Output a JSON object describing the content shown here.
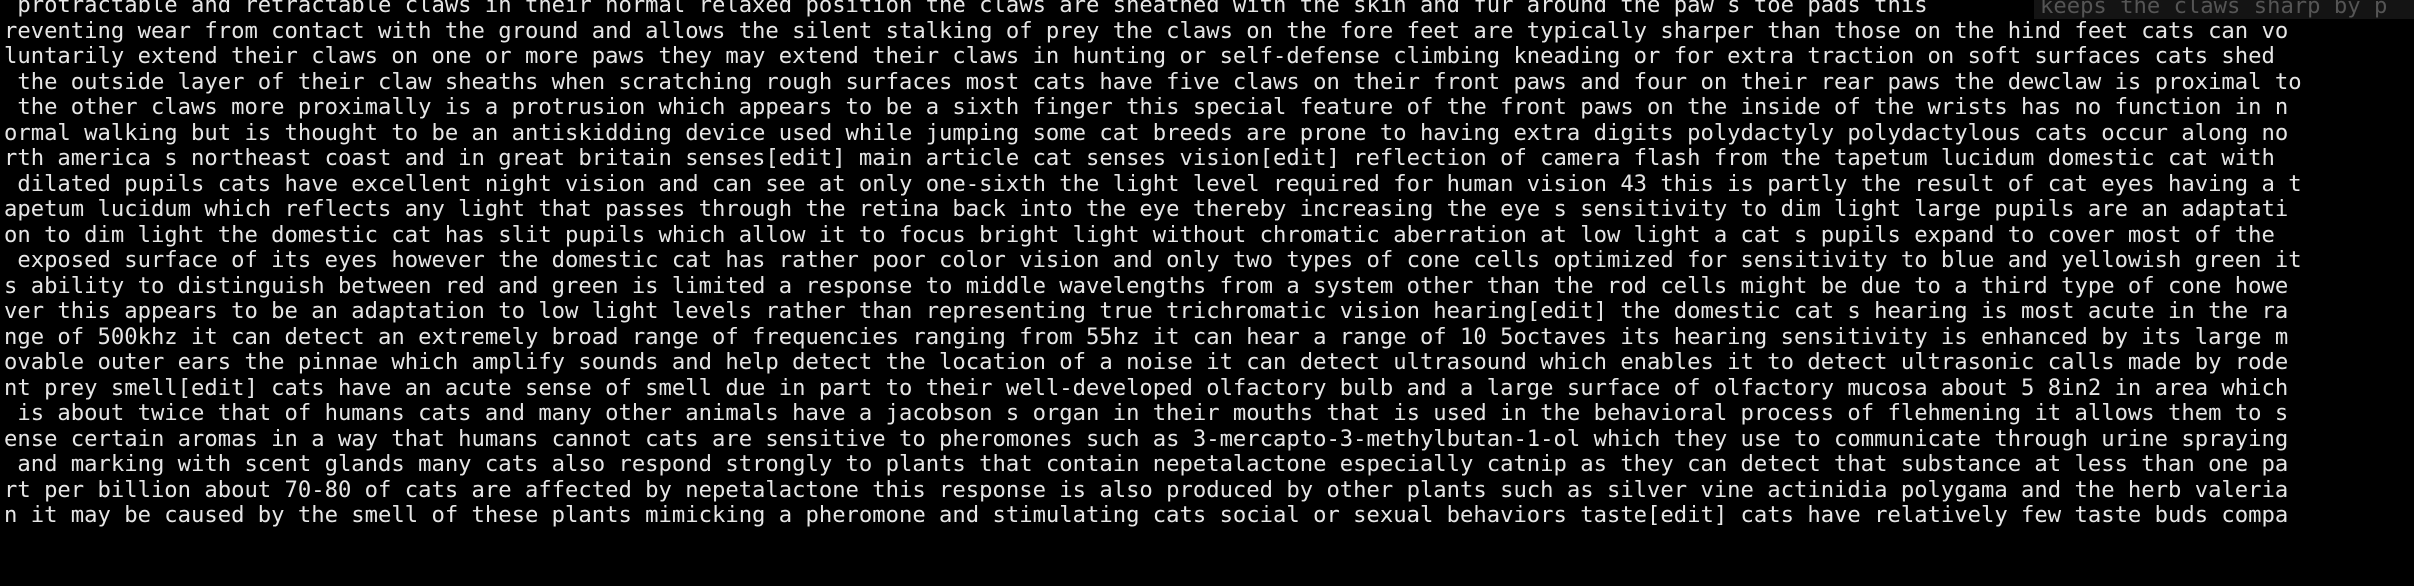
{
  "terminal": {
    "lines": [
      " protractable and retractable claws in their normal relaxed position the claws are sheathed with the skin and fur around the paw s toe pads this",
      "reventing wear from contact with the ground and allows the silent stalking of prey the claws on the fore feet are typically sharper than those on the hind feet cats can vo",
      "luntarily extend their claws on one or more paws they may extend their claws in hunting or self-defense climbing kneading or for extra traction on soft surfaces cats shed",
      " the outside layer of their claw sheaths when scratching rough surfaces most cats have five claws on their front paws and four on their rear paws the dewclaw is proximal to",
      " the other claws more proximally is a protrusion which appears to be a sixth finger this special feature of the front paws on the inside of the wrists has no function in n",
      "ormal walking but is thought to be an antiskidding device used while jumping some cat breeds are prone to having extra digits polydactyly polydactylous cats occur along no",
      "rth america s northeast coast and in great britain senses[edit] main article cat senses vision[edit] reflection of camera flash from the tapetum lucidum domestic cat with",
      " dilated pupils cats have excellent night vision and can see at only one-sixth the light level required for human vision 43 this is partly the result of cat eyes having a t",
      "apetum lucidum which reflects any light that passes through the retina back into the eye thereby increasing the eye s sensitivity to dim light large pupils are an adaptati",
      "on to dim light the domestic cat has slit pupils which allow it to focus bright light without chromatic aberration at low light a cat s pupils expand to cover most of the",
      " exposed surface of its eyes however the domestic cat has rather poor color vision and only two types of cone cells optimized for sensitivity to blue and yellowish green it",
      "s ability to distinguish between red and green is limited a response to middle wavelengths from a system other than the rod cells might be due to a third type of cone howe",
      "ver this appears to be an adaptation to low light levels rather than representing true trichromatic vision hearing[edit] the domestic cat s hearing is most acute in the ra",
      "nge of 500khz it can detect an extremely broad range of frequencies ranging from 55hz it can hear a range of 10 5octaves its hearing sensitivity is enhanced by its large m",
      "ovable outer ears the pinnae which amplify sounds and help detect the location of a noise it can detect ultrasound which enables it to detect ultrasonic calls made by rode",
      "nt prey smell[edit] cats have an acute sense of smell due in part to their well-developed olfactory bulb and a large surface of olfactory mucosa about 5 8in2 in area which",
      " is about twice that of humans cats and many other animals have a jacobson s organ in their mouths that is used in the behavioral process of flehmening it allows them to s",
      "ense certain aromas in a way that humans cannot cats are sensitive to pheromones such as 3-mercapto-3-methylbutan-1-ol which they use to communicate through urine spraying",
      " and marking with scent glands many cats also respond strongly to plants that contain nepetalactone especially catnip as they can detect that substance at less than one pa",
      "rt per billion about 70-80 of cats are affected by nepetalactone this response is also produced by other plants such as silver vine actinidia polygama and the herb valeria",
      "n it may be caused by the smell of these plants mimicking a pheromone and stimulating cats social or sexual behaviors taste[edit] cats have relatively few taste buds compa"
    ],
    "overlay_text": "keeps the claws sharp by p",
    "background_color": "#000000",
    "text_color": "#e6e6e6"
  }
}
